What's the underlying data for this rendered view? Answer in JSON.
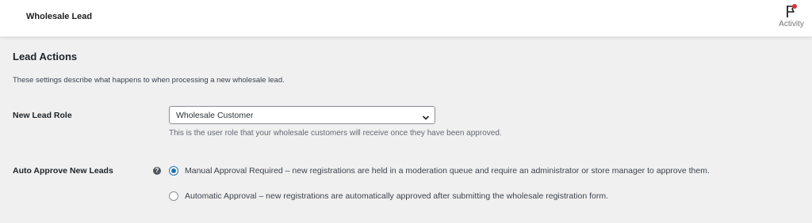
{
  "header": {
    "title": "Wholesale Lead",
    "activity_label": "Activity"
  },
  "section": {
    "title": "Lead Actions",
    "description": "These settings describe what happens to when processing a new wholesale lead."
  },
  "new_lead_role": {
    "label": "New Lead Role",
    "selected": "Wholesale Customer",
    "help": "This is the user role that your wholesale customers will receive once they have been approved."
  },
  "auto_approve": {
    "label": "Auto Approve New Leads",
    "options": [
      {
        "label": "Manual Approval Required – new registrations are held in a moderation queue and require an administrator or store manager to approve them.",
        "checked": true
      },
      {
        "label": "Automatic Approval – new registrations are automatically approved after submitting the wholesale registration form.",
        "checked": false
      }
    ]
  },
  "colors": {
    "accent": "#2271b1",
    "notification_dot": "#d63638"
  }
}
